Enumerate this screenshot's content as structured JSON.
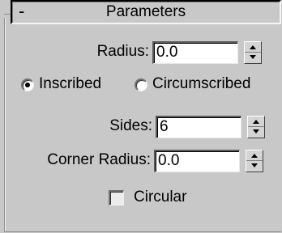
{
  "rollout": {
    "collapse_symbol": "-",
    "title": "Parameters"
  },
  "radius": {
    "label": "Radius:",
    "value": "0.0"
  },
  "mode": {
    "inscribed_label": "Inscribed",
    "circumscribed_label": "Circumscribed",
    "selected": "Inscribed"
  },
  "sides": {
    "label": "Sides:",
    "value": "6"
  },
  "corner_radius": {
    "label": "Corner Radius:",
    "value": "0.0"
  },
  "circular": {
    "label": "Circular",
    "checked": false
  }
}
